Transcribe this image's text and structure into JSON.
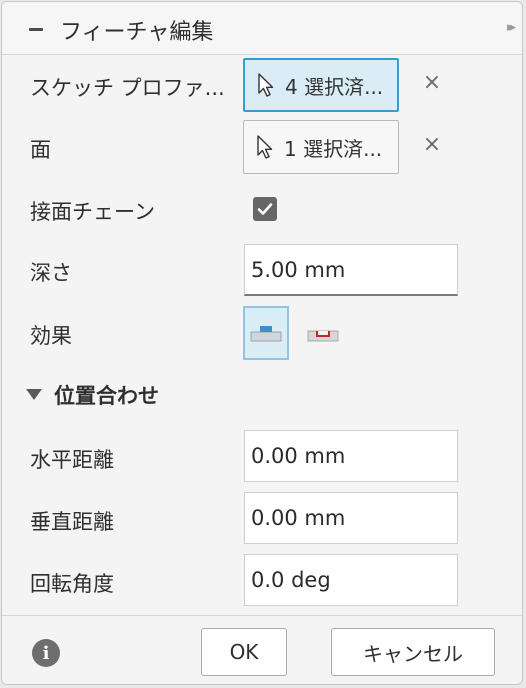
{
  "header": {
    "title": "フィーチャ編集",
    "collapse_icon": "minus-icon",
    "expand_icon": "double-chevron-right-icon"
  },
  "rows": {
    "sketch_profile": {
      "label": "スケッチ プロファ...",
      "button": "4 選択済..."
    },
    "face": {
      "label": "面",
      "button": "1 選択済..."
    },
    "tangent_chain": {
      "label": "接面チェーン",
      "checked": true
    },
    "depth": {
      "label": "深さ",
      "value": "5.00 mm"
    },
    "effect": {
      "label": "効果",
      "options": [
        "emboss-icon",
        "deboss-icon"
      ],
      "selected": 0
    }
  },
  "position_section": {
    "title": "位置合わせ",
    "horizontal": {
      "label": "水平距離",
      "value": "0.00 mm"
    },
    "vertical": {
      "label": "垂直距離",
      "value": "0.00 mm"
    },
    "rotation": {
      "label": "回転角度",
      "value": "0.0 deg"
    }
  },
  "footer": {
    "info_icon": "info-icon",
    "ok_label": "OK",
    "cancel_label": "キャンセル"
  },
  "colors": {
    "accent": "#3a9ccc",
    "selected_bg": "#daedf6",
    "deboss_red": "#c0272d",
    "emboss_blue": "#3f8fd0"
  }
}
